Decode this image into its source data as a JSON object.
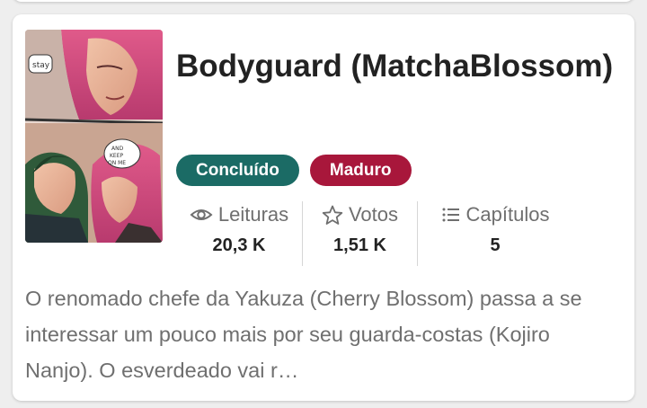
{
  "story": {
    "title": "Bodyguard (MatchaBlossom)",
    "cover_alt": "Bodyguard cover art",
    "tags": [
      {
        "label": "Concluído",
        "color": "#1b6b65"
      },
      {
        "label": "Maduro",
        "color": "#a8173b"
      }
    ],
    "stats": {
      "reads": {
        "label": "Leituras",
        "value": "20,3 K",
        "icon": "eye-icon"
      },
      "votes": {
        "label": "Votos",
        "value": "1,51 K",
        "icon": "star-outline-icon"
      },
      "parts": {
        "label": "Capítulos",
        "value": "5",
        "icon": "list-icon"
      }
    },
    "description": "O renomado chefe da Yakuza (Cherry Blossom) passa a se interessar um pouco mais por seu guarda-costas (Kojiro Nanjo). O esverdeado vai r…"
  },
  "colors": {
    "title": "#222222",
    "muted": "#6f6f6f",
    "card_background": "#ffffff",
    "page_background": "#eeeeee"
  }
}
